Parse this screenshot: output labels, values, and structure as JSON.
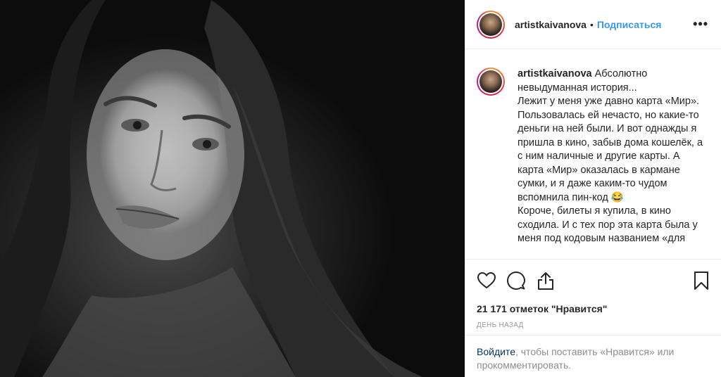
{
  "post": {
    "username": "artistkaivanova",
    "separator": "•",
    "follow_label": "Подписаться",
    "more_label": "•••",
    "caption": "Абсолютно невыдуманная история...\nЛежит у меня уже давно карта «Мир». Пользовалась ей нечасто, но какие-то деньги на ней были. И вот однажды я пришла в кино, забыв дома кошелёк, а с ним наличные и другие карты. А карта «Мир» оказалась в кармане сумки, и я даже каким-то чудом вспомнила пин-код 😂\nКороче, билеты я купила, в кино сходила. И с тех пор эта карта была у меня под кодовым названием «для",
    "likes_text": "21 171 отметок \"Нравится\"",
    "time_text": "ДЕНЬ НАЗАД",
    "login_link": "Войдите",
    "login_text": ", чтобы поставить «Нравится» или прокомментировать."
  },
  "icons": {
    "like": "heart-icon",
    "comment": "comment-bubble-icon",
    "share": "share-icon",
    "save": "bookmark-icon"
  },
  "colors": {
    "accent": "#3897f0",
    "link_dark": "#003569",
    "muted": "#8e8e8e",
    "divider": "#efefef"
  }
}
